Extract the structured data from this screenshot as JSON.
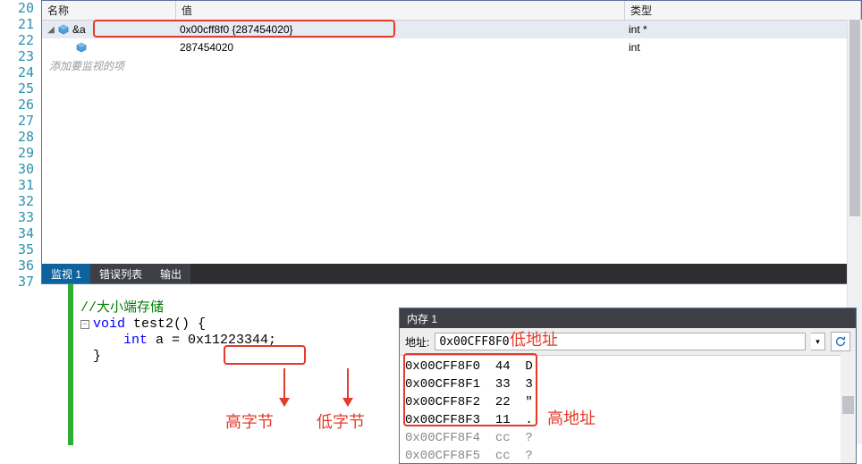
{
  "gutter_lines": [
    "20",
    "21",
    "22",
    "23",
    "24",
    "25",
    "26",
    "27",
    "28",
    "29",
    "30",
    "31",
    "32",
    "33",
    "34",
    "35",
    "36",
    "37"
  ],
  "watch": {
    "headers": {
      "name": "名称",
      "value": "值",
      "type": "类型"
    },
    "rows": [
      {
        "name": "&a",
        "value": "0x00cff8f0 {287454020}",
        "type": "int *",
        "level": 0,
        "expanded": true
      },
      {
        "name": "",
        "value": "287454020",
        "type": "int",
        "level": 1,
        "expanded": false
      }
    ],
    "placeholder": "添加要监视的项"
  },
  "tabs": {
    "watch": "监视 1",
    "errors": "错误列表",
    "output": "输出"
  },
  "code": {
    "comment": "//大小端存储",
    "line2_pre": "void",
    "line2_mid": " test2",
    "line2_post": "() {",
    "line3_pre": "int",
    "line3_mid": " a = 0x",
    "line3_val": "11223344",
    "line3_end": ";",
    "line4": "}"
  },
  "labels": {
    "high_byte": "高字节",
    "low_byte": "低字节",
    "low_addr": "低地址",
    "high_addr": "高地址"
  },
  "memory": {
    "title": "内存 1",
    "addr_label": "地址:",
    "addr_value": "0x00CFF8F0",
    "rows": [
      {
        "addr": "0x00CFF8F0",
        "hex": "44",
        "ascii": "D",
        "gray": false
      },
      {
        "addr": "0x00CFF8F1",
        "hex": "33",
        "ascii": "3",
        "gray": false
      },
      {
        "addr": "0x00CFF8F2",
        "hex": "22",
        "ascii": "\"",
        "gray": false
      },
      {
        "addr": "0x00CFF8F3",
        "hex": "11",
        "ascii": ".",
        "gray": false
      },
      {
        "addr": "0x00CFF8F4",
        "hex": "cc",
        "ascii": "?",
        "gray": true
      },
      {
        "addr": "0x00CFF8F5",
        "hex": "cc",
        "ascii": "?",
        "gray": true
      }
    ]
  }
}
